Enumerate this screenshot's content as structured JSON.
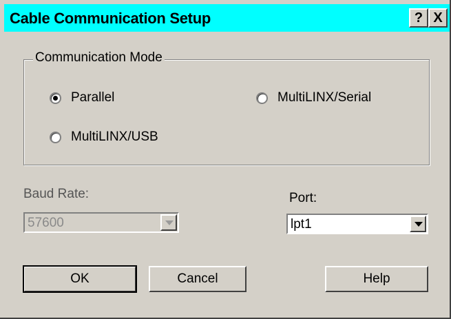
{
  "window": {
    "title": "Cable Communication Setup",
    "help_button": "?",
    "close_button": "X",
    "title_bar_color": "#00ffff"
  },
  "communication_mode": {
    "legend": "Communication Mode",
    "options": [
      {
        "label": "Parallel",
        "selected": true
      },
      {
        "label": "MultiLINX/Serial",
        "selected": false
      },
      {
        "label": "MultiLINX/USB",
        "selected": false
      }
    ]
  },
  "baud_rate": {
    "label": "Baud Rate:",
    "value": "57600",
    "enabled": false
  },
  "port": {
    "label": "Port:",
    "value": "lpt1",
    "enabled": true
  },
  "buttons": {
    "ok": "OK",
    "cancel": "Cancel",
    "help": "Help"
  }
}
